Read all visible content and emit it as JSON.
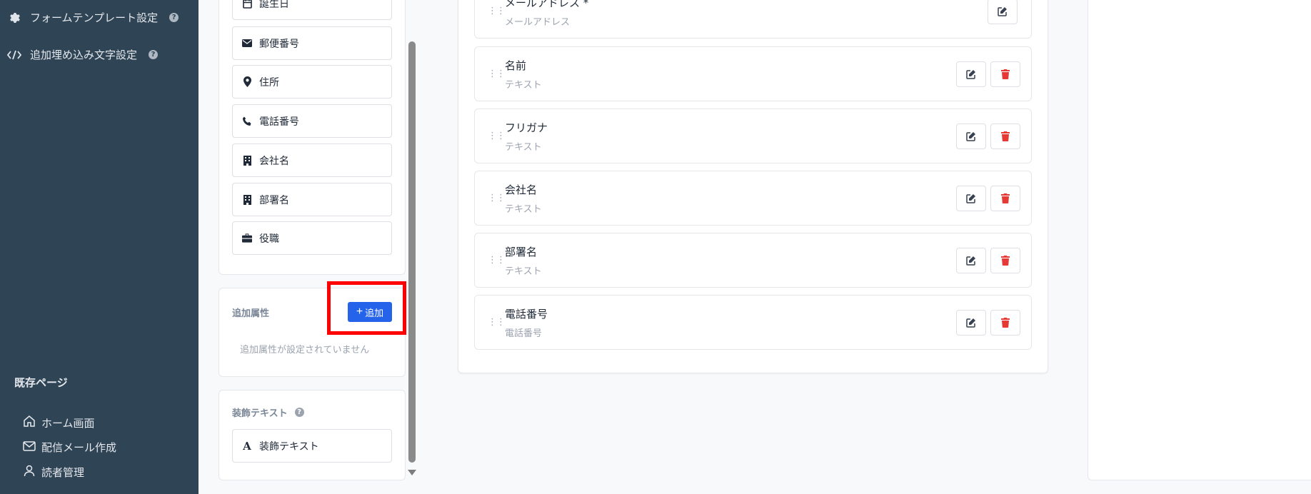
{
  "sidebar": {
    "form_template_settings": "フォームテンプレート設定",
    "extra_embed_text_settings": "追加埋め込み文字設定",
    "existing_pages_title": "既存ページ",
    "nav": [
      {
        "label": "ホーム画面",
        "icon": "home-icon"
      },
      {
        "label": "配信メール作成",
        "icon": "mail-icon"
      },
      {
        "label": "読者管理",
        "icon": "user-icon"
      }
    ]
  },
  "fields_panel": {
    "fields": [
      {
        "label": "誕生日",
        "icon": "calendar-icon"
      },
      {
        "label": "郵便番号",
        "icon": "envelope-icon"
      },
      {
        "label": "住所",
        "icon": "map-pin-icon"
      },
      {
        "label": "電話番号",
        "icon": "phone-icon"
      },
      {
        "label": "会社名",
        "icon": "building-icon"
      },
      {
        "label": "部署名",
        "icon": "building-icon"
      },
      {
        "label": "役職",
        "icon": "briefcase-icon"
      }
    ],
    "extra_attributes": {
      "title": "追加属性",
      "add_label": "追加",
      "empty_message": "追加属性が設定されていません"
    },
    "decoration": {
      "title": "装飾テキスト",
      "button_label": "装飾テキスト"
    }
  },
  "form_rows": [
    {
      "label": "メールアドレス *",
      "type": "メールアドレス",
      "deletable": false
    },
    {
      "label": "名前",
      "type": "テキスト",
      "deletable": true
    },
    {
      "label": "フリガナ",
      "type": "テキスト",
      "deletable": true
    },
    {
      "label": "会社名",
      "type": "テキスト",
      "deletable": true
    },
    {
      "label": "部署名",
      "type": "テキスト",
      "deletable": true
    },
    {
      "label": "電話番号",
      "type": "電話番号",
      "deletable": true
    }
  ],
  "colors": {
    "sidebar_bg": "#2f4455",
    "primary": "#2563eb",
    "danger": "#e53935",
    "highlight": "#ff0000"
  }
}
